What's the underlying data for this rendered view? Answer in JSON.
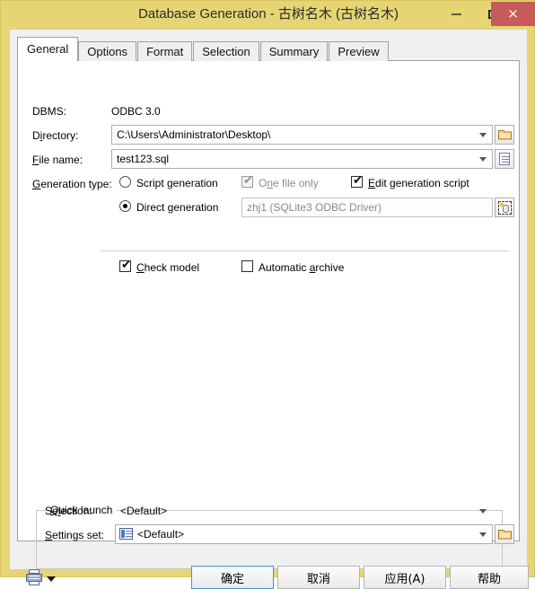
{
  "window": {
    "title": "Database Generation - 古树名木 (古树名木)",
    "caption_buttons": {
      "minimize": "minimize-button",
      "maximize": "maximize-button",
      "close": "×"
    },
    "frame_color": "#e6d572",
    "close_color": "#c75b5b"
  },
  "tabs": [
    {
      "label": "General",
      "active": true
    },
    {
      "label": "Options",
      "active": false
    },
    {
      "label": "Format",
      "active": false
    },
    {
      "label": "Selection",
      "active": false
    },
    {
      "label": "Summary",
      "active": false
    },
    {
      "label": "Preview",
      "active": false
    }
  ],
  "general": {
    "dbms": {
      "label": "DBMS:",
      "value": "ODBC 3.0"
    },
    "directory": {
      "label_pre": "D",
      "label_acc": "i",
      "label_post": "rectory:",
      "value": "C:\\Users\\Administrator\\Desktop\\",
      "browse_icon": "folder-icon"
    },
    "file_name": {
      "label_pre": "",
      "label_acc": "F",
      "label_post": "ile name:",
      "value": "test123.sql",
      "browse_icon": "document-icon"
    },
    "generation_type": {
      "label_pre": "",
      "label_acc": "G",
      "label_post": "eneration type:",
      "options": [
        {
          "label_pre": "Script generation",
          "selected": false
        },
        {
          "label_pre": "Direct generation",
          "selected": true
        }
      ]
    },
    "one_file_only": {
      "pre": "O",
      "acc": "n",
      "post": "e file only",
      "checked": true,
      "disabled": true
    },
    "edit_generation_script": {
      "pre": "",
      "acc": "E",
      "post": "dit generation script",
      "checked": true,
      "disabled": false
    },
    "data_source": {
      "value": "zhj1 (SQLite3 ODBC Driver)",
      "disabled": true,
      "browse_icon": "database-icon"
    },
    "check_model": {
      "pre": "",
      "acc": "C",
      "post": "heck model",
      "checked": true
    },
    "automatic_archive": {
      "pre": "Automatic ",
      "acc": "a",
      "post": "rchive",
      "checked": false
    }
  },
  "quick_launch": {
    "title_pre": "",
    "title_acc": "Q",
    "title_post": "uick launch",
    "selection": {
      "label_pre": "Se",
      "label_acc": "l",
      "label_post": "ection:",
      "value": "<Default>"
    },
    "settings_set": {
      "label_pre": "",
      "label_acc": "S",
      "label_post": "ettings set:",
      "value": "<Default>",
      "icon": "list-settings-icon",
      "browse_icon": "folder-icon"
    }
  },
  "footer": {
    "report_icon": "printer-icon",
    "report_caret": "caret-down-icon",
    "buttons": [
      {
        "label": "确定",
        "default": true
      },
      {
        "label": "取消",
        "default": false
      },
      {
        "label": "应用(A)",
        "default": false
      },
      {
        "label": "帮助",
        "default": false
      }
    ]
  }
}
